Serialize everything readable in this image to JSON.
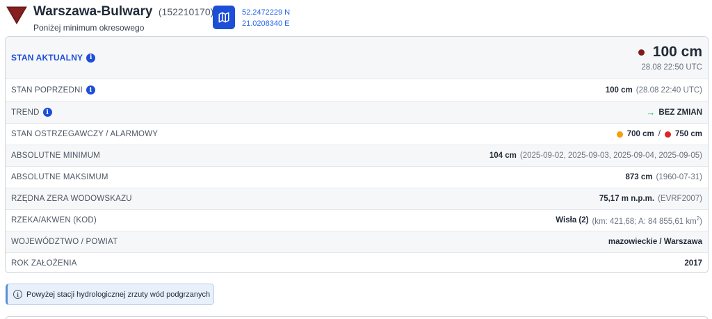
{
  "header": {
    "station_name": "Warszawa-Bulwary",
    "station_code": "(152210170)",
    "status": "Poniżej minimum okresowego",
    "map_icon": "map-icon",
    "lat": "52.2472229 N",
    "lon": "21.0208340 E",
    "status_color": "#7f1d1d"
  },
  "current": {
    "label": "STAN AKTUALNY",
    "value": "100 cm",
    "time": "28.08 22:50 UTC",
    "dot_color": "#7f1d1d"
  },
  "rows": {
    "previous": {
      "label": "STAN POPRZEDNI",
      "value": "100 cm",
      "note": "(28.08 22:40 UTC)"
    },
    "trend": {
      "label": "TREND",
      "value": "BEZ ZMIAN",
      "arrow": "→",
      "arrow_color": "#22c55e"
    },
    "warning": {
      "label": "STAN OSTRZEGAWCZY / ALARMOWY",
      "warn_value": "700 cm",
      "alarm_value": "750 cm",
      "separator": "/",
      "warn_color": "#f59e0b",
      "alarm_color": "#dc2626"
    },
    "abs_min": {
      "label": "ABSOLUTNE MINIMUM",
      "value": "104 cm",
      "note": "(2025-09-02, 2025-09-03, 2025-09-04, 2025-09-05)"
    },
    "abs_max": {
      "label": "ABSOLUTNE MAKSIMUM",
      "value": "873 cm",
      "note": "(1960-07-31)"
    },
    "datum": {
      "label": "RZĘDNA ZERA WODOWSKAZU",
      "value": "75,17 m n.p.m.",
      "note": "(EVRF2007)"
    },
    "river": {
      "label": "RZEKA/AKWEN (KOD)",
      "value": "Wisła (2)",
      "note": "(km: 421,68; A: 84 855,61 km",
      "note_sup": "2",
      "note_end": ")"
    },
    "region": {
      "label": "WOJEWÓDZTWO / POWIAT",
      "value": "mazowieckie / Warszawa"
    },
    "founded": {
      "label": "ROK ZAŁOŻENIA",
      "value": "2017"
    }
  },
  "alert": {
    "text": "Powyżej stacji hydrologicznej zrzuty wód podgrzanych",
    "icon": "info-circle-icon"
  }
}
